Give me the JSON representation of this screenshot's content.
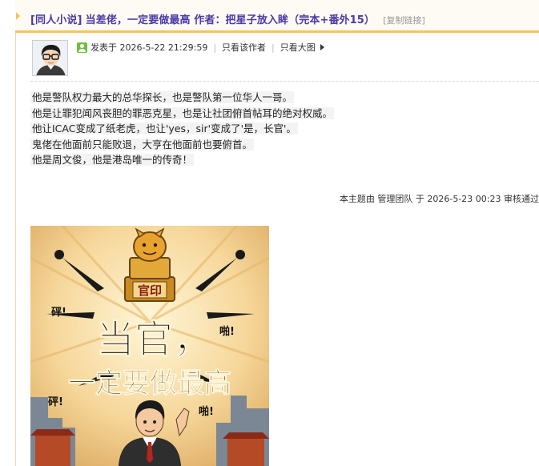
{
  "thread": {
    "category": "[同人小说]",
    "title": "当差佬，一定要做最高 作者：把星子放入眸（完本+番外15）",
    "copy_link": "[复制链接]"
  },
  "post_meta": {
    "posted_label": "发表于 2026-5-22 21:29:59",
    "only_author_label": "只看该作者",
    "only_image_label": "只看大图",
    "sep": "|"
  },
  "post": {
    "lines": [
      "他是警队权力最大的总华探长，也是警队第一位华人一哥。",
      "他是让罪犯闻风丧胆的罪恶克星，也是让社团俯首帖耳的绝对权威。",
      "他让ICAC变成了纸老虎，也让'yes，sir'变成了'是，长官'。",
      "鬼佬在他面前只能败退，大亨在他面前也要俯首。",
      "他是周文俊，他是港岛唯一的传奇！"
    ],
    "edit_note": "本主题由 管理团队 于 2026-5-23 00:23 审核通过"
  },
  "poster": {
    "seal_label": "官印",
    "title_line1": "当官，",
    "title_line2": "一定要做最高",
    "sfx": [
      "砰!",
      "啪!",
      "砰!",
      "啪!"
    ]
  },
  "colors": {
    "title": "#4a3aa6",
    "accent": "#f2c55c",
    "online": "#6fbf3c"
  }
}
